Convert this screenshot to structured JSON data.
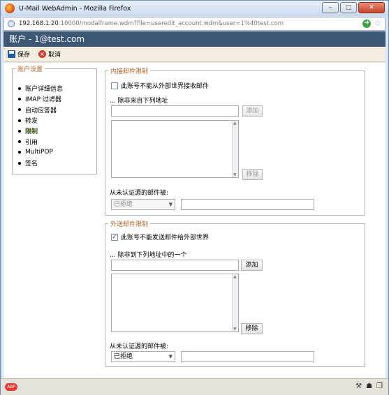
{
  "window": {
    "title": "U-Mail WebAdmin - Mozilla Firefox",
    "btn_minimize": "–",
    "btn_maximize": "□",
    "btn_close": "✕"
  },
  "url": {
    "host": "192.168.1.20",
    "rest": ":10000/modalframe.wdm?file=useredit_account.wdm&user=1%40test.com"
  },
  "header": {
    "title": "账户 - 1@test.com"
  },
  "toolbar": {
    "save_label": "保存",
    "cancel_label": "取消"
  },
  "sidebar": {
    "legend": "账户设置",
    "items": [
      {
        "label": "账户详细信息"
      },
      {
        "label": "IMAP 过滤器"
      },
      {
        "label": "自动应答器"
      },
      {
        "label": "转发"
      },
      {
        "label": "限制"
      },
      {
        "label": "引用"
      },
      {
        "label": "MultiPOP"
      },
      {
        "label": "签名"
      }
    ]
  },
  "inbound": {
    "legend": "内接邮件限制",
    "checkbox_label": "此账号不能从外部世界接收邮件",
    "checked": false,
    "except_label": "... 除非来自下列地址",
    "add_label": "添加",
    "remove_label": "移除",
    "unauth_label": "从未认证源的邮件被:",
    "select_value": "已拒绝"
  },
  "outbound": {
    "legend": "外送邮件限制",
    "checkbox_label": "此账号不能发送邮件给外部世界",
    "checked": true,
    "except_label": "... 除非到下列地址中的一个",
    "add_label": "添加",
    "remove_label": "移除",
    "unauth_label": "从未认证源的邮件被:",
    "select_value": "已拒绝"
  },
  "statusbar": {
    "addon_label": "ABP"
  }
}
